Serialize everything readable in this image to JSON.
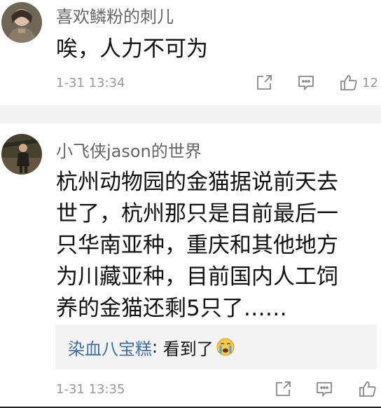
{
  "comments": [
    {
      "username": "喜欢鳞粉的刺儿",
      "text": "唉，人力不可为",
      "time": "1-31 13:34",
      "likes": "12"
    },
    {
      "username": "小飞侠jason的世界",
      "text_lines": [
        "杭州动物园的金猫据说前天去",
        "世了，杭州那只是目前最后一",
        "只华南亚种，重庆和其他地方",
        "为川藏亚种，目前国内人工饲",
        "养的金猫还剩5只了……"
      ],
      "reply": {
        "name": "染血八宝糕",
        "separator": ": ",
        "text": "看到了",
        "emoji": "crying-face"
      },
      "time": "1-31 13:35",
      "likes": ""
    }
  ],
  "icons": [
    "share-icon",
    "comment-icon",
    "thumbs-up-icon"
  ],
  "colors": {
    "reply_name": "#3c6fa6",
    "meta_text": "#999999",
    "separator": "#f2f2f2",
    "reply_bg": "#f3f3f3"
  }
}
